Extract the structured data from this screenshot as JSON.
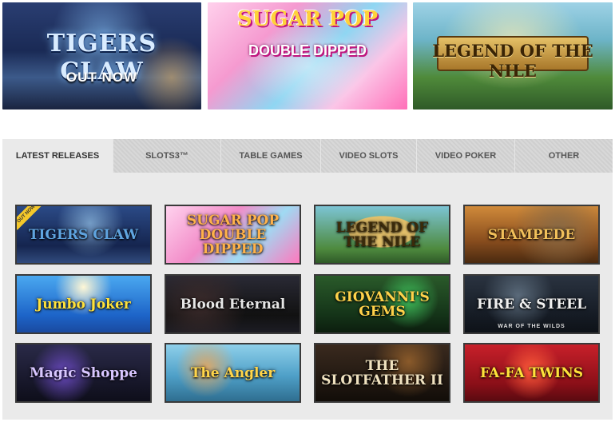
{
  "banners": [
    {
      "id": "tigers-claw",
      "title": "TIGERS CLAW",
      "subtitle": "OUT NOW"
    },
    {
      "id": "sugar-pop-2",
      "title": "SUGAR POP",
      "subtitle": "DOUBLE DIPPED"
    },
    {
      "id": "legend-nile",
      "title": "LEGEND OF THE NILE"
    }
  ],
  "tabs": [
    {
      "label": "LATEST RELEASES",
      "active": true
    },
    {
      "label": "SLOTS3™",
      "active": false
    },
    {
      "label": "TABLE GAMES",
      "active": false
    },
    {
      "label": "VIDEO SLOTS",
      "active": false
    },
    {
      "label": "VIDEO POKER",
      "active": false
    },
    {
      "label": "OTHER",
      "active": false
    }
  ],
  "games": [
    {
      "title": "TIGERS CLAW",
      "badge": "OUT NOW",
      "color": "#5fa4e0"
    },
    {
      "title": "SUGAR POP DOUBLE DIPPED",
      "color": "#ffb24a"
    },
    {
      "title": "LEGEND OF THE NILE",
      "color": "#3b2a0a"
    },
    {
      "title": "STAMPEDE",
      "color": "#f2c05a"
    },
    {
      "title": "Jumbo Joker",
      "color": "#ffe13a"
    },
    {
      "title": "Blood Eternal",
      "color": "#e6e6e6"
    },
    {
      "title": "GIOVANNI'S GEMS",
      "color": "#ffd24a"
    },
    {
      "title": "FIRE & STEEL",
      "subtitle": "WAR OF THE WILDS",
      "color": "#f0f0f0"
    },
    {
      "title": "Magic Shoppe",
      "color": "#d8c6ff"
    },
    {
      "title": "The Angler",
      "color": "#ffd54a"
    },
    {
      "title": "THE SLOTFATHER II",
      "color": "#f0e2c0"
    },
    {
      "title": "FA-FA TWINS",
      "color": "#ffe23a"
    }
  ]
}
